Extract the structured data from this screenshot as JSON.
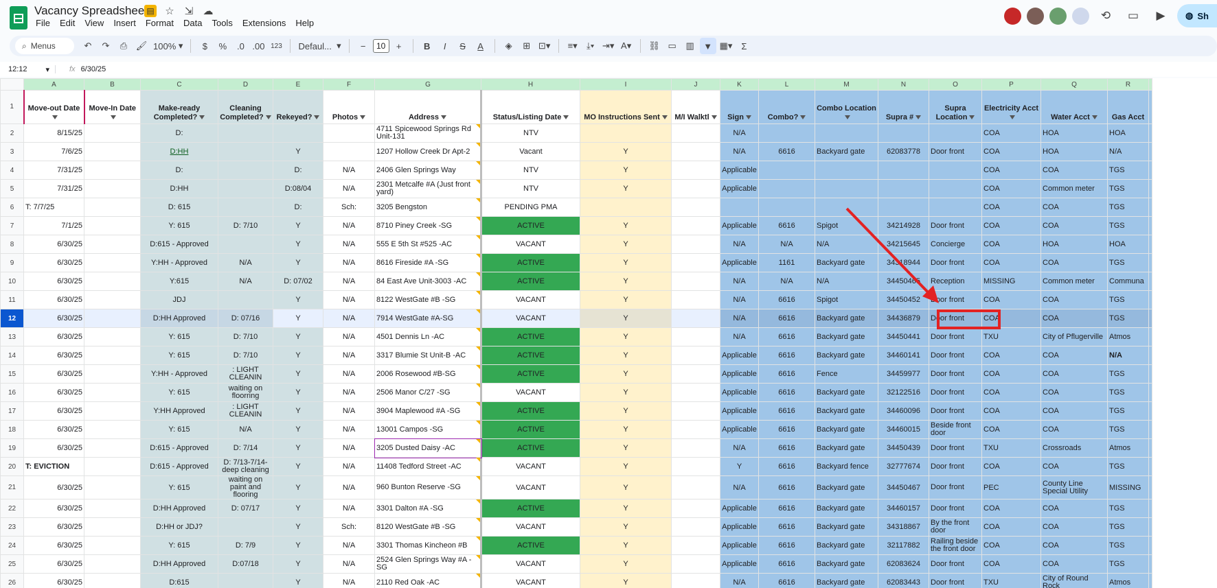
{
  "app": {
    "title": "Vacancy Spreadsheet",
    "menus": [
      "File",
      "Edit",
      "View",
      "Insert",
      "Format",
      "Data",
      "Tools",
      "Extensions",
      "Help"
    ],
    "share_label": "Sh"
  },
  "toolbar": {
    "menus_label": "Menus",
    "zoom": "100%",
    "currency": "$",
    "percent": "%",
    "dec_minus": ".0",
    "dec_plus": ".00",
    "number_format": "123",
    "font": "Defaul...",
    "font_size": "10",
    "bold": "B",
    "italic": "I"
  },
  "formula": {
    "cell": "12:12",
    "fx": "fx",
    "value": "6/30/25"
  },
  "columns": [
    "A",
    "B",
    "C",
    "D",
    "E",
    "F",
    "G",
    "H",
    "I",
    "J",
    "K",
    "L",
    "M",
    "N",
    "O",
    "P",
    "Q",
    "R"
  ],
  "headers": [
    "Move-out Date",
    "Move-In Date",
    "Make-ready Completed?",
    "Cleaning Completed?",
    "Rekeyed?",
    "Photos",
    "Address",
    "Status/Listing Date",
    "MO Instructions Sent",
    "M/I Walktl",
    "Sign",
    "Combo?",
    "Combo Location",
    "Supra #",
    "Supra Location",
    "Electricity Acct",
    "Water Acct",
    "Gas Acct"
  ],
  "rows": [
    {
      "n": "2",
      "c": [
        "8/15/25",
        "",
        "D:",
        "",
        "",
        "",
        "4711 Spicewood Springs Rd Unit-131",
        "NTV",
        "",
        "",
        "N/A",
        "",
        "",
        "",
        "",
        "COA",
        "HOA",
        "HOA"
      ]
    },
    {
      "n": "3",
      "c": [
        "7/6/25",
        "",
        "D:HH",
        "",
        "Y",
        "",
        "1207 Hollow Creek Dr Apt-2",
        "Vacant",
        "Y",
        "",
        "N/A",
        "6616",
        "Backyard gate",
        "62083778",
        "Door front",
        "COA",
        "HOA",
        "N/A"
      ]
    },
    {
      "n": "4",
      "c": [
        "7/31/25",
        "",
        "D:",
        "",
        "D:",
        "N/A",
        "2406 Glen Springs Way",
        "NTV",
        "Y",
        "",
        "Applicable",
        "",
        "",
        "",
        "",
        "COA",
        "COA",
        "TGS"
      ]
    },
    {
      "n": "5",
      "c": [
        "7/31/25",
        "",
        "D:HH",
        "",
        "D:08/04",
        "N/A",
        "2301 Metcalfe #A (Just front yard)",
        "NTV",
        "Y",
        "",
        "Applicable",
        "",
        "",
        "",
        "",
        "COA",
        "Common meter",
        "TGS"
      ]
    },
    {
      "n": "6",
      "c": [
        "T: 7/7/25",
        "",
        "D: 615",
        "",
        "D:",
        "Sch:",
        "3205 Bengston",
        "PENDING PMA",
        "",
        "",
        "",
        "",
        "",
        "",
        "",
        "COA",
        "COA",
        "TGS"
      ]
    },
    {
      "n": "7",
      "c": [
        "7/1/25",
        "",
        "Y: 615",
        "D: 7/10",
        "Y",
        "N/A",
        "8710 Piney Creek -SG",
        "ACTIVE",
        "Y",
        "",
        "Applicable",
        "6616",
        "Spigot",
        "34214928",
        "Door front",
        "COA",
        "COA",
        "TGS"
      ]
    },
    {
      "n": "8",
      "c": [
        "6/30/25",
        "",
        "D:615 - Approved",
        "",
        "Y",
        "N/A",
        "555 E 5th St #525 -AC",
        "VACANT",
        "Y",
        "",
        "N/A",
        "N/A",
        "N/A",
        "34215645",
        "Concierge",
        "COA",
        "HOA",
        "HOA"
      ]
    },
    {
      "n": "9",
      "c": [
        "6/30/25",
        "",
        "Y:HH - Approved",
        "N/A",
        "Y",
        "N/A",
        "8616 Fireside #A -SG",
        "ACTIVE",
        "Y",
        "",
        "Applicable",
        "1161",
        "Backyard gate",
        "34318944",
        "Door front",
        "COA",
        "COA",
        "TGS"
      ]
    },
    {
      "n": "10",
      "c": [
        "6/30/25",
        "",
        "Y:615",
        "N/A",
        "D: 07/02",
        "N/A",
        "84 East Ave Unit-3003 -AC",
        "ACTIVE",
        "Y",
        "",
        "N/A",
        "N/A",
        "N/A",
        "34450465",
        "Reception",
        "MISSING",
        "Common meter",
        "Communa"
      ]
    },
    {
      "n": "11",
      "c": [
        "6/30/25",
        "",
        "JDJ",
        "",
        "Y",
        "N/A",
        "8122 WestGate #B -SG",
        "VACANT",
        "Y",
        "",
        "N/A",
        "6616",
        "Spigot",
        "34450452",
        "Door front",
        "COA",
        "COA",
        "TGS"
      ]
    },
    {
      "n": "12",
      "c": [
        "6/30/25",
        "",
        "D:HH Approved",
        "D: 07/16",
        "Y",
        "N/A",
        "7914 WestGate #A-SG",
        "VACANT",
        "Y",
        "",
        "N/A",
        "6616",
        "Backyard gate",
        "34436879",
        "Door front",
        "COA",
        "COA",
        "TGS"
      ]
    },
    {
      "n": "13",
      "c": [
        "6/30/25",
        "",
        "Y: 615",
        "D: 7/10",
        "Y",
        "N/A",
        "4501 Dennis Ln -AC",
        "ACTIVE",
        "Y",
        "",
        "N/A",
        "6616",
        "Backyard gate",
        "34450441",
        "Door front",
        "TXU",
        "City of Pflugerville",
        "Atmos"
      ]
    },
    {
      "n": "14",
      "c": [
        "6/30/25",
        "",
        "Y: 615",
        "D: 7/10",
        "Y",
        "N/A",
        "3317 Blumie St Unit-B -AC",
        "ACTIVE",
        "Y",
        "",
        "Applicable",
        "6616",
        "Backyard gate",
        "34460141",
        "Door front",
        "COA",
        "COA",
        "N/A"
      ]
    },
    {
      "n": "15",
      "c": [
        "6/30/25",
        "",
        "Y:HH - Approved",
        ": LIGHT CLEANIN",
        "Y",
        "N/A",
        "2006 Rosewood #B-SG",
        "ACTIVE",
        "Y",
        "",
        "Applicable",
        "6616",
        "Fence",
        "34459977",
        "Door front",
        "COA",
        "COA",
        "TGS"
      ]
    },
    {
      "n": "16",
      "c": [
        "6/30/25",
        "",
        "Y: 615",
        "waiting on floorring",
        "Y",
        "N/A",
        "2506 Manor C/27 -SG",
        "VACANT",
        "Y",
        "",
        "Applicable",
        "6616",
        "Backyard gate",
        "32122516",
        "Door front",
        "COA",
        "COA",
        "TGS"
      ]
    },
    {
      "n": "17",
      "c": [
        "6/30/25",
        "",
        "Y:HH Approved",
        ": LIGHT CLEANIN",
        "Y",
        "N/A",
        "3904 Maplewood #A -SG",
        "ACTIVE",
        "Y",
        "",
        "Applicable",
        "6616",
        "Backyard gate",
        "34460096",
        "Door front",
        "COA",
        "COA",
        "TGS"
      ]
    },
    {
      "n": "18",
      "c": [
        "6/30/25",
        "",
        "Y: 615",
        "N/A",
        "Y",
        "N/A",
        "13001 Campos -SG",
        "ACTIVE",
        "Y",
        "",
        "Applicable",
        "6616",
        "Backyard gate",
        "34460015",
        "Beside front door",
        "COA",
        "COA",
        "TGS"
      ]
    },
    {
      "n": "19",
      "c": [
        "6/30/25",
        "",
        "D:615 - Approved",
        "D: 7/14",
        "Y",
        "N/A",
        "3205 Dusted Daisy -AC",
        "ACTIVE",
        "Y",
        "",
        "N/A",
        "6616",
        "Backyard gate",
        "34450439",
        "Door front",
        "TXU",
        "Crossroads",
        "Atmos"
      ]
    },
    {
      "n": "20",
      "c": [
        "T: EVICTION",
        "",
        "D:615 - Approved",
        "D: 7/13-7/14- deep cleaning",
        "Y",
        "N/A",
        "11408 Tedford Street -AC",
        "VACANT",
        "Y",
        "",
        "Y",
        "6616",
        "Backyard fence",
        "32777674",
        "Door front",
        "COA",
        "COA",
        "TGS"
      ]
    },
    {
      "n": "21",
      "c": [
        "6/30/25",
        "",
        "Y: 615",
        "waiting on paint and flooring",
        "Y",
        "N/A",
        "960 Bunton Reserve -SG",
        "VACANT",
        "Y",
        "",
        "N/A",
        "6616",
        "Backyard gate",
        "34450467",
        "Door front",
        "PEC",
        "County Line Special Utility",
        "MISSING"
      ]
    },
    {
      "n": "22",
      "c": [
        "6/30/25",
        "",
        "D:HH Approved",
        "D: 07/17",
        "Y",
        "N/A",
        "3301 Dalton #A -SG",
        "ACTIVE",
        "Y",
        "",
        "Applicable",
        "6616",
        "Backyard gate",
        "34460157",
        "Door front",
        "COA",
        "COA",
        "TGS"
      ]
    },
    {
      "n": "23",
      "c": [
        "6/30/25",
        "",
        "D:HH or JDJ?",
        "",
        "Y",
        "Sch:",
        "8120 WestGate #B -SG",
        "VACANT",
        "Y",
        "",
        "Applicable",
        "6616",
        "Backyard gate",
        "34318867",
        "By the front door",
        "COA",
        "COA",
        "TGS"
      ]
    },
    {
      "n": "24",
      "c": [
        "6/30/25",
        "",
        "Y: 615",
        "D: 7/9",
        "Y",
        "N/A",
        "3301 Thomas Kincheon #B",
        "ACTIVE",
        "Y",
        "",
        "Applicable",
        "6616",
        "Backyard gate",
        "32117882",
        "Railing beside the front door",
        "COA",
        "COA",
        "TGS"
      ]
    },
    {
      "n": "25",
      "c": [
        "6/30/25",
        "",
        "D:HH Approved",
        "D:07/18",
        "Y",
        "N/A",
        "2524 Glen Springs Way #A -SG",
        "VACANT",
        "Y",
        "",
        "Applicable",
        "6616",
        "Backyard gate",
        "62083624",
        "Door front",
        "COA",
        "COA",
        "TGS"
      ]
    },
    {
      "n": "26",
      "c": [
        "6/30/25",
        "",
        "D:615",
        "",
        "Y",
        "N/A",
        "2110 Red Oak -AC",
        "VACANT",
        "Y",
        "",
        "N/A",
        "6616",
        "Backyard gate",
        "62083443",
        "Door front",
        "TXU",
        "City of Round Rock",
        "Atmos"
      ]
    }
  ],
  "colors": {
    "active": "#34a853",
    "make_ready": "#d0e0e3",
    "mo_sent": "#fff2cc",
    "blue_block": "#9fc5e8",
    "annotation": "#e32222"
  }
}
